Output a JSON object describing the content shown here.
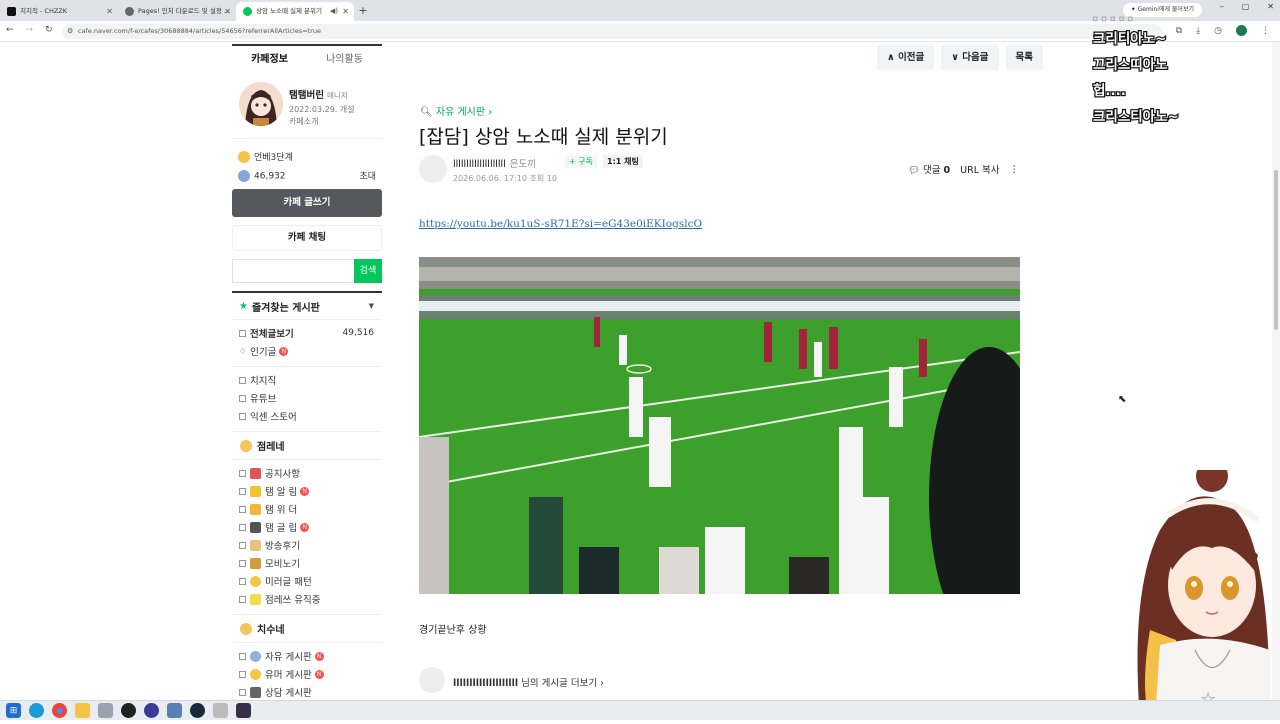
{
  "browser": {
    "tabs": [
      {
        "title": "치지직 - CHZZK",
        "color": "#111111",
        "active": false
      },
      {
        "title": "Pages! 인처 다운로드 및 설정 ...",
        "color": "#444444",
        "active": false
      },
      {
        "title": "상암 노소때 실제 분위기",
        "color": "#03c75a",
        "active": true
      }
    ],
    "new_tab": "+",
    "gemini_button": "Gemini에게 물어보기",
    "url": "cafe.naver.com/f-e/cafes/30688884/articles/54656?referrerAllArticles=true",
    "window_controls": [
      "–",
      "▢",
      "✕"
    ]
  },
  "sidebar": {
    "tabs": [
      "카페정보",
      "나의활동"
    ],
    "cafe_manager": "탬탬버린",
    "manager_role": "매니저",
    "date": "2022.03.29. 개설",
    "intro": "카페소개",
    "level": "언베3단계",
    "members": "46,932",
    "invite": "초대",
    "write_button": "카페 글쓰기",
    "chat_button": "카페 채팅",
    "search_placeholder": "",
    "search_button": "검색",
    "favorites_title": "즐겨찾는 게시판",
    "all_posts": "전체글보기",
    "all_posts_count": "49,516",
    "popular": "인기글",
    "boards1": [
      "치지직",
      "유튜브",
      "익센 스토어"
    ],
    "group1": "점레네",
    "boards2": [
      "공지사항",
      "탬 알 림",
      "탬 위 더",
      "탬 글 립",
      "방송후기",
      "모비노기",
      "미러글 패턴",
      "점레쓰 유직중"
    ],
    "group2": "치수네",
    "boards3": [
      "자유 게시판",
      "유머 게시판",
      "상담 게시판"
    ]
  },
  "article": {
    "prev": "이전글",
    "next": "다음글",
    "list": "목록",
    "board": "자유 게시판 ›",
    "title": "[잡담] 상암 노소때 실제 분위기",
    "writer": "llllllllllllllllllll",
    "writer_grade": "은도끼",
    "subscribe": "+ 구독",
    "chat": "1:1 채팅",
    "date": "2026.06.06. 17:10",
    "views": "조회 10",
    "comments_label": "댓글",
    "comments_count": "0",
    "url_copy": "URL 복사",
    "link": "https://youtu.be/ku1uS-sR71E?si=eG43e0iEKIogslcO",
    "caption": "경기끝난후 상황",
    "more_posts": "님의 게시글 더보기 ›"
  },
  "overlay": {
    "lines": [
      "크리티아노~",
      "끄리스띠아노",
      "헙....",
      "크리스티아노~"
    ]
  }
}
